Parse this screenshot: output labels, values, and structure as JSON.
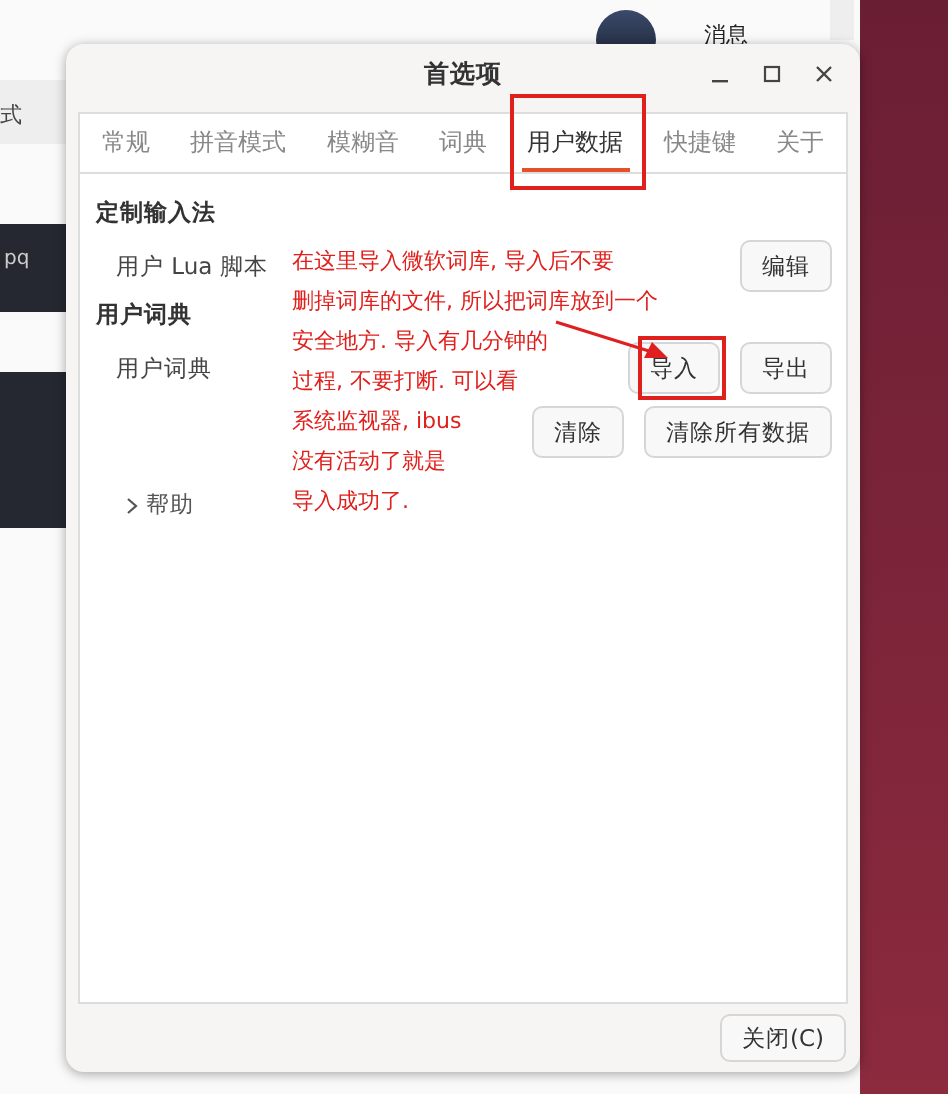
{
  "background_page": {
    "toolbar": [
      {
        "label": "式"
      }
    ],
    "code_snippet": "pq",
    "profile": {
      "label": "消息"
    }
  },
  "window": {
    "title": "首选项"
  },
  "tabs": [
    {
      "label": "常规",
      "selected": false,
      "highlighted": false
    },
    {
      "label": "拼音模式",
      "selected": false,
      "highlighted": false
    },
    {
      "label": "模糊音",
      "selected": false,
      "highlighted": false
    },
    {
      "label": "词典",
      "selected": false,
      "highlighted": false
    },
    {
      "label": "用户数据",
      "selected": true,
      "highlighted": true
    },
    {
      "label": "快捷键",
      "selected": false,
      "highlighted": false
    },
    {
      "label": "关于",
      "selected": false,
      "highlighted": false
    }
  ],
  "sections": [
    {
      "title": "定制输入法",
      "rows": [
        {
          "label": "用户 Lua 脚本",
          "buttons": [
            {
              "label": "编辑",
              "highlighted": false
            }
          ]
        }
      ]
    },
    {
      "title": "用户词典",
      "rows": [
        {
          "label": "用户词典",
          "buttons": [
            {
              "label": "导入",
              "highlighted": true
            },
            {
              "label": "导出",
              "highlighted": false
            }
          ]
        },
        {
          "buttons": [
            {
              "label": "清除",
              "highlighted": false
            },
            {
              "label": "清除所有数据",
              "highlighted": false
            }
          ]
        }
      ]
    }
  ],
  "help": {
    "label": "帮助",
    "expanded": false
  },
  "annotation": [
    "在这里导入微软词库, 导入后不要",
    "删掉词库的文件, 所以把词库放到一个",
    "安全地方. 导入有几分钟的",
    "过程, 不要打断. 可以看",
    "系统监视器, ibus",
    "没有活动了就是",
    "导入成功了."
  ],
  "close_button": "关闭(C)"
}
